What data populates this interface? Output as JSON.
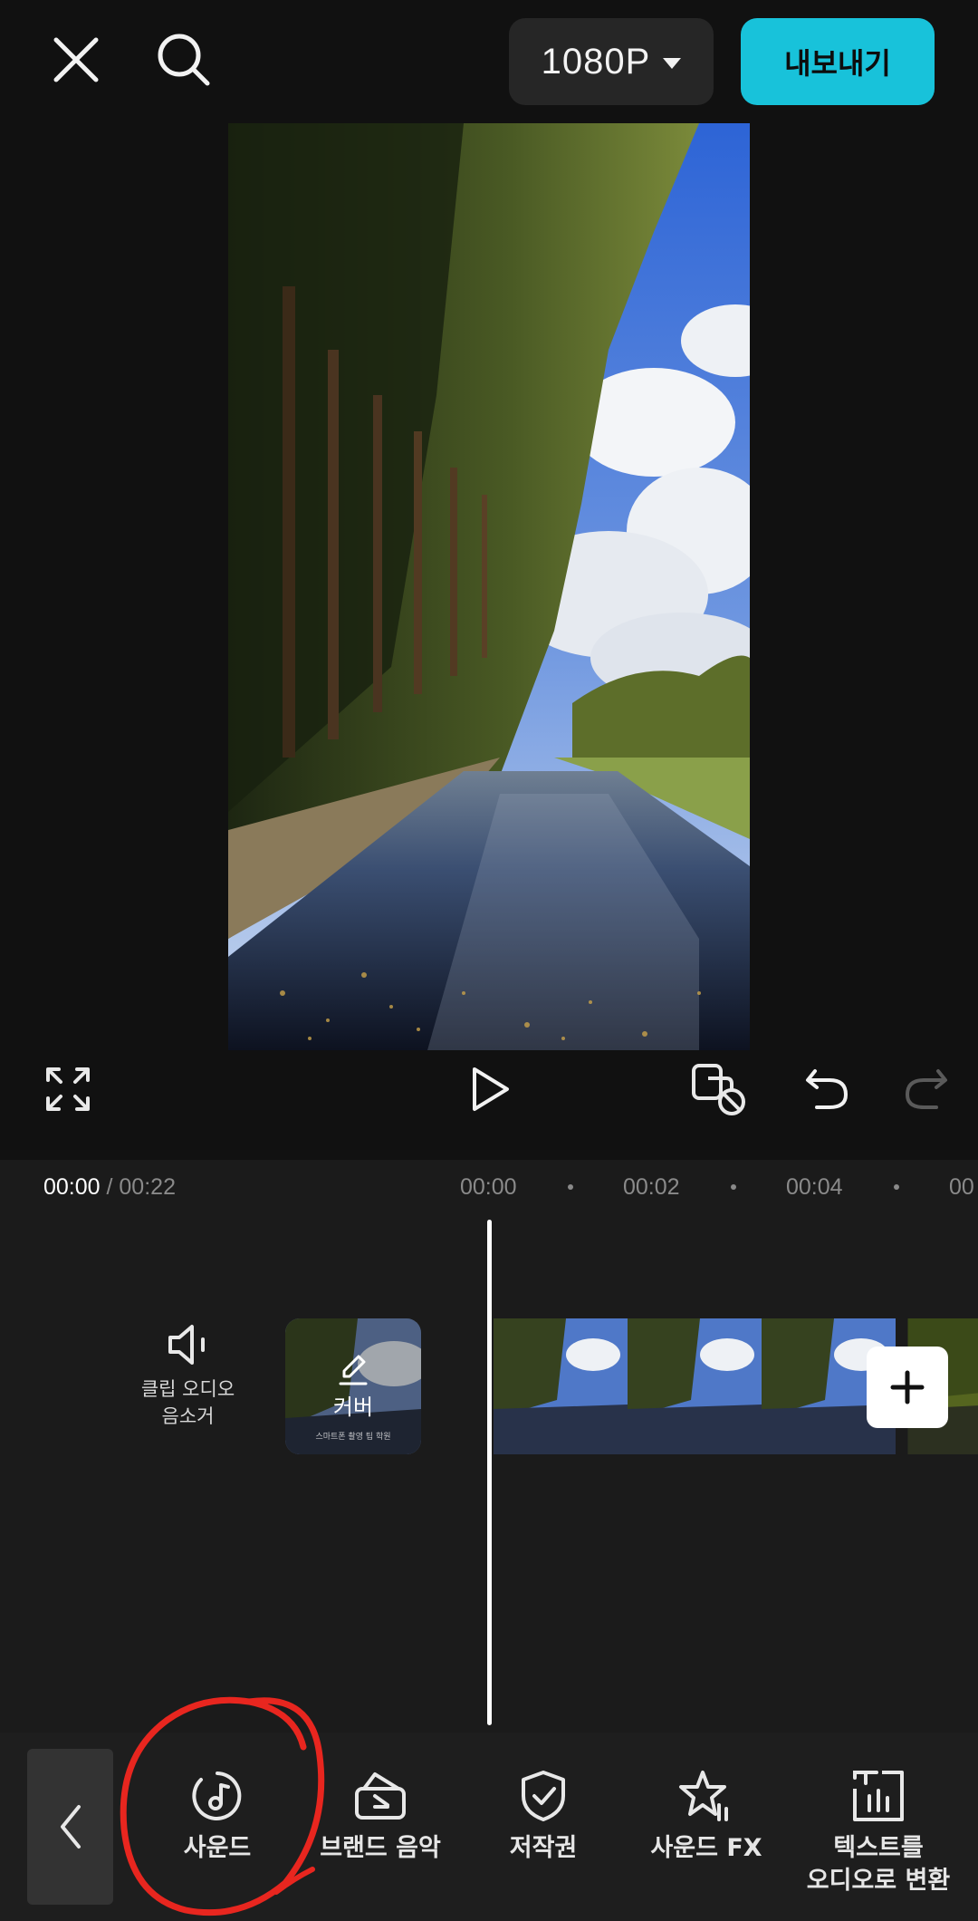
{
  "topbar": {
    "close_icon": "close-icon",
    "search_icon": "search-icon",
    "resolution": "1080P",
    "export_label": "내보내기"
  },
  "colors": {
    "accent": "#18c2da",
    "background": "#111111",
    "timeline_bg": "#1b1b1b",
    "toolbar_bg": "#1e1e1e",
    "annotation": "#e8261f"
  },
  "controls": {
    "fullscreen_icon": "fullscreen-icon",
    "play_icon": "play-icon",
    "keyframe_icon": "keyframe-off-icon",
    "undo_icon": "undo-icon",
    "redo_icon": "redo-icon"
  },
  "timeline": {
    "current_time": "00:00",
    "separator": " / ",
    "total_time": "00:22",
    "ruler": [
      "00:00",
      "00:02",
      "00:04",
      "00"
    ],
    "mute_label_line1": "클립 오디오",
    "mute_label_line2": "음소거",
    "cover_label": "커버",
    "cover_sub": "스마트폰 촬영 팁 학원"
  },
  "toolbar": {
    "items": [
      {
        "label": "사운드",
        "icon": "music-note-icon"
      },
      {
        "label": "브랜드 음악",
        "icon": "brand-music-icon"
      },
      {
        "label": "저작권",
        "icon": "shield-check-icon"
      },
      {
        "label": "사운드 FX",
        "icon": "star-fx-icon"
      },
      {
        "label_line1": "텍스트를",
        "label_line2": "오디오로 변환",
        "icon": "text-to-audio-icon"
      }
    ]
  }
}
